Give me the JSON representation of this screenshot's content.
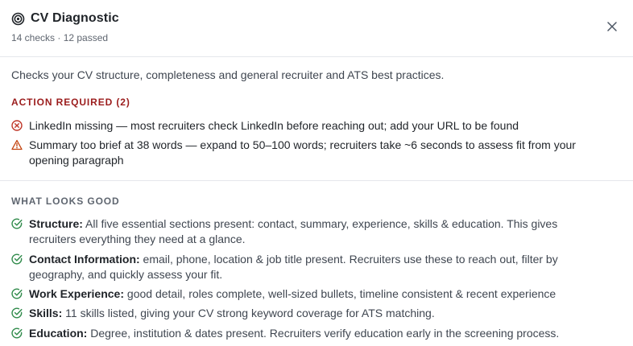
{
  "header": {
    "title": "CV Diagnostic",
    "subtitle": "14 checks · 12 passed",
    "title_icon": "target-icon",
    "close_icon": "close-icon"
  },
  "description": "Checks your CV structure, completeness and general recruiter and ATS best practices.",
  "action_required": {
    "title": "ACTION REQUIRED (2)",
    "items": [
      {
        "icon": "error-circle-icon",
        "text": "LinkedIn missing — most recruiters check LinkedIn before reaching out; add your URL to be found"
      },
      {
        "icon": "warning-triangle-icon",
        "text": "Summary too brief at 38 words — expand to 50–100 words; recruiters take ~6 seconds to assess fit from your opening paragraph"
      }
    ]
  },
  "looks_good": {
    "title": "WHAT LOOKS GOOD",
    "items": [
      {
        "icon": "check-circle-icon",
        "label": "Structure:",
        "text": " All five essential sections present: contact, summary, experience, skills & education. This gives recruiters everything they need at a glance."
      },
      {
        "icon": "check-circle-icon",
        "label": "Contact Information:",
        "text": " email, phone, location & job title present. Recruiters use these to reach out, filter by geography, and quickly assess your fit."
      },
      {
        "icon": "check-circle-icon",
        "label": "Work Experience:",
        "text": " good detail, roles complete, well-sized bullets, timeline consistent & recent experience"
      },
      {
        "icon": "check-circle-icon",
        "label": "Skills:",
        "text": " 11 skills listed, giving your CV strong keyword coverage for ATS matching."
      },
      {
        "icon": "check-circle-icon",
        "label": "Education:",
        "text": " Degree, institution & dates present. Recruiters verify education early in the screening process."
      }
    ]
  },
  "colors": {
    "error": "#c0392b",
    "warning": "#c2410c",
    "success": "#2f8a4a",
    "required_heading": "#9b1c1c"
  }
}
